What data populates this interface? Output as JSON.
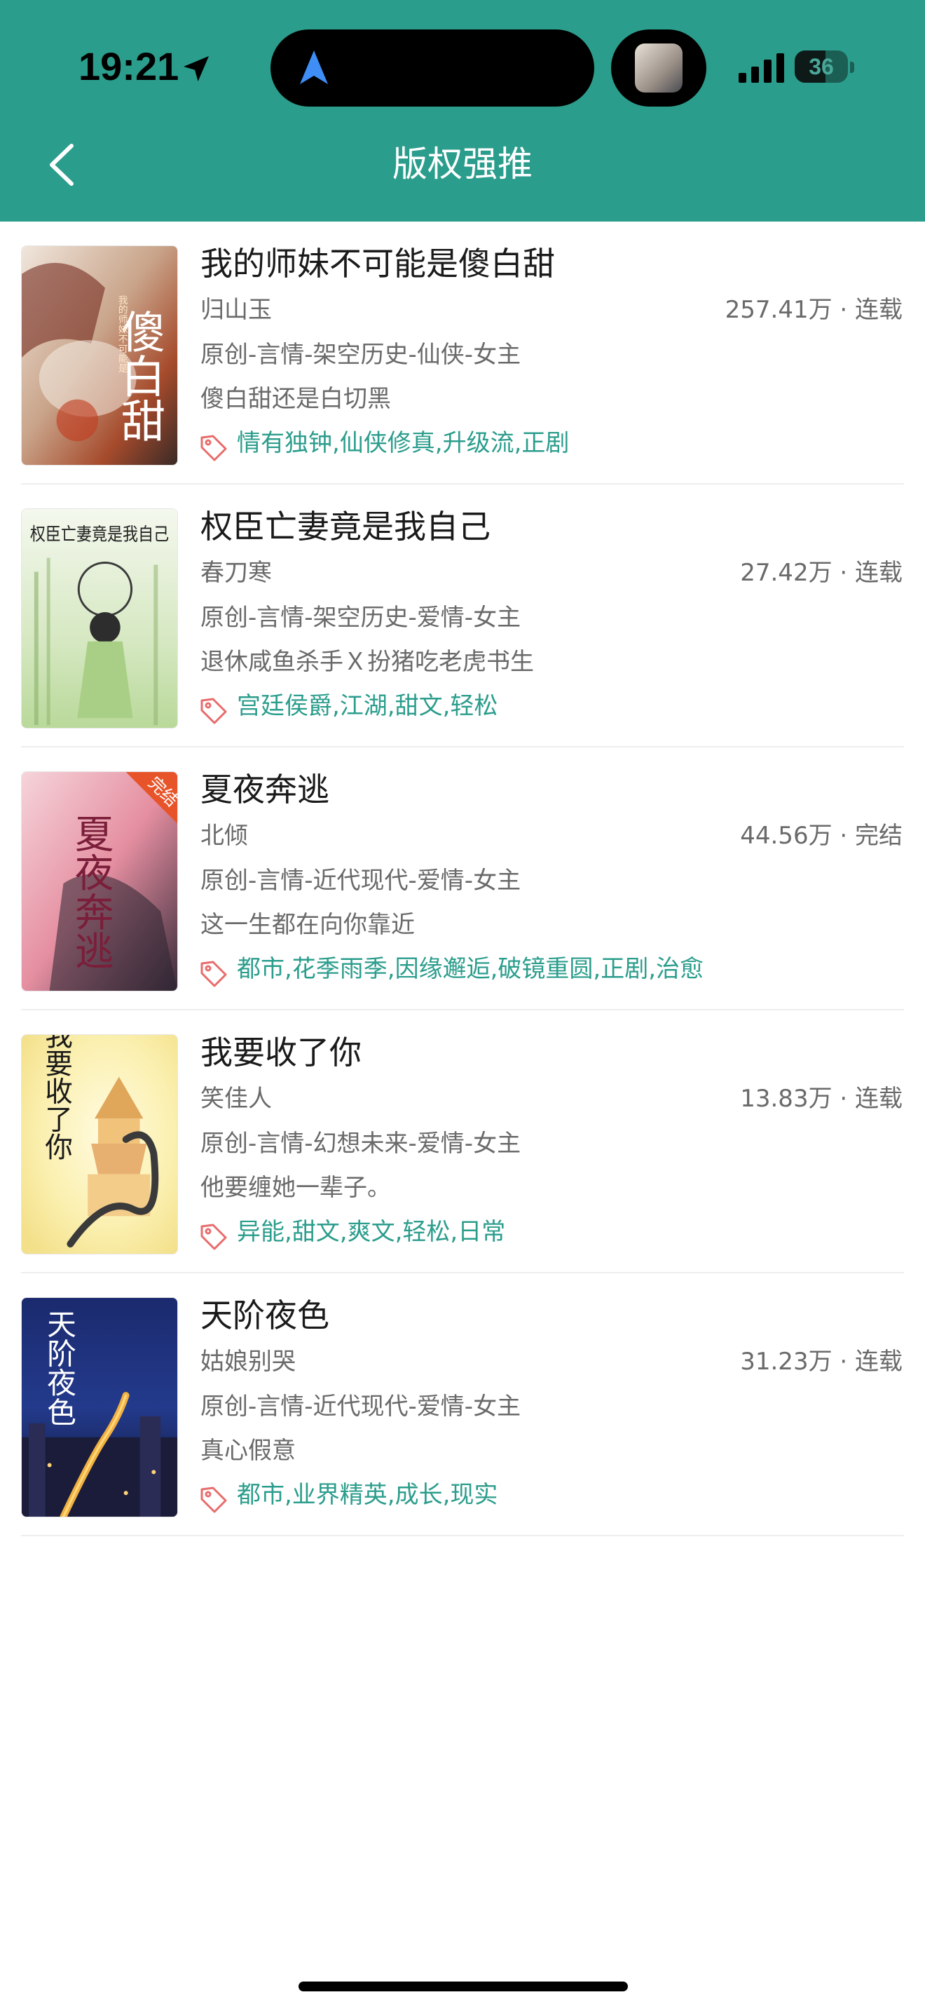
{
  "status_bar": {
    "time": "19:21",
    "battery": "36"
  },
  "header": {
    "title": "版权强推",
    "accent_color": "#2b9d8c",
    "back_icon": "chevron-left-icon"
  },
  "books": [
    {
      "title": "我的师妹不可能是傻白甜",
      "author": "归山玉",
      "meta": "257.41万 · 连载",
      "category": "原创-言情-架空历史-仙侠-女主",
      "intro": "傻白甜还是白切黑",
      "tags": "情有独钟,仙侠修真,升级流,正剧"
    },
    {
      "title": "权臣亡妻竟是我自己",
      "author": "春刀寒",
      "meta": "27.42万 · 连载",
      "category": "原创-言情-架空历史-爱情-女主",
      "intro": "退休咸鱼杀手Ｘ扮猪吃老虎书生",
      "tags": "宫廷侯爵,江湖,甜文,轻松"
    },
    {
      "title": "夏夜奔逃",
      "author": "北倾",
      "meta": "44.56万 · 完结",
      "category": "原创-言情-近代现代-爱情-女主",
      "intro": "这一生都在向你靠近",
      "tags": "都市,花季雨季,因缘邂逅,破镜重圆,正剧,治愈"
    },
    {
      "title": "我要收了你",
      "author": "笑佳人",
      "meta": "13.83万 · 连载",
      "category": "原创-言情-幻想未来-爱情-女主",
      "intro": "他要缠她一辈子。",
      "tags": "异能,甜文,爽文,轻松,日常"
    },
    {
      "title": "天阶夜色",
      "author": "姑娘别哭",
      "meta": "31.23万 · 连载",
      "category": "原创-言情-近代现代-爱情-女主",
      "intro": "真心假意",
      "tags": "都市,业界精英,成长,现实"
    }
  ],
  "covers": [
    {
      "text": "傻白甜",
      "subtitle": "我的师妹不可能是"
    },
    {
      "text": "权臣亡妻竟是我自己"
    },
    {
      "text": "夏夜奔逃",
      "badge": "完结"
    },
    {
      "text": "我要收了你"
    },
    {
      "text": "天阶夜色"
    }
  ]
}
